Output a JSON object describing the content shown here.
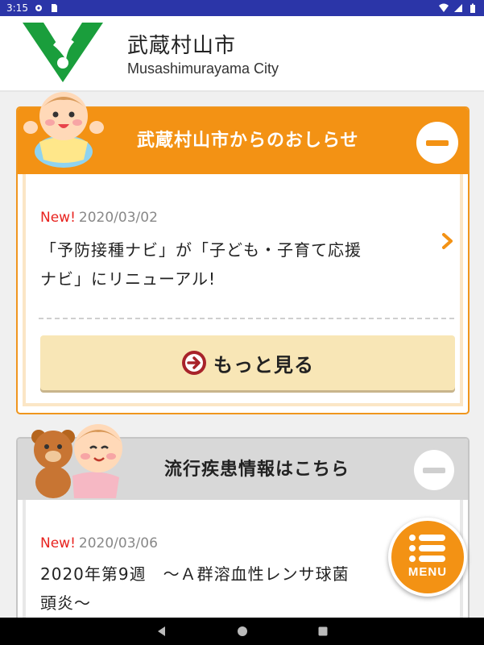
{
  "status_bar": {
    "time": "3:15",
    "icons": [
      "settings-icon",
      "sd-card-icon",
      "wifi-icon",
      "signal-icon",
      "battery-icon"
    ]
  },
  "header": {
    "title": "武蔵村山市",
    "subtitle": "Musashimurayama City",
    "logo_color": "#1a9e3c"
  },
  "notice_section": {
    "title": "武蔵村山市からのおしらせ",
    "accent_color": "#f39214",
    "items": [
      {
        "badge": "New!",
        "date": "2020/03/02",
        "line1": "「予防接種ナビ」が「子ども・子育て応援",
        "line2": "ナビ」にリニューアル!"
      }
    ],
    "more_label": "もっと見る"
  },
  "epidemic_section": {
    "title": "流行疾患情報はこちら",
    "items": [
      {
        "badge": "New!",
        "date": "2020/03/06",
        "line1": "2020年第9週　～Ａ群溶血性レンサ球菌",
        "line2": "頭炎～"
      }
    ]
  },
  "menu_button": {
    "label": "MENU"
  },
  "nav_bar": {
    "buttons": [
      "back-icon",
      "home-icon",
      "recents-icon"
    ]
  }
}
